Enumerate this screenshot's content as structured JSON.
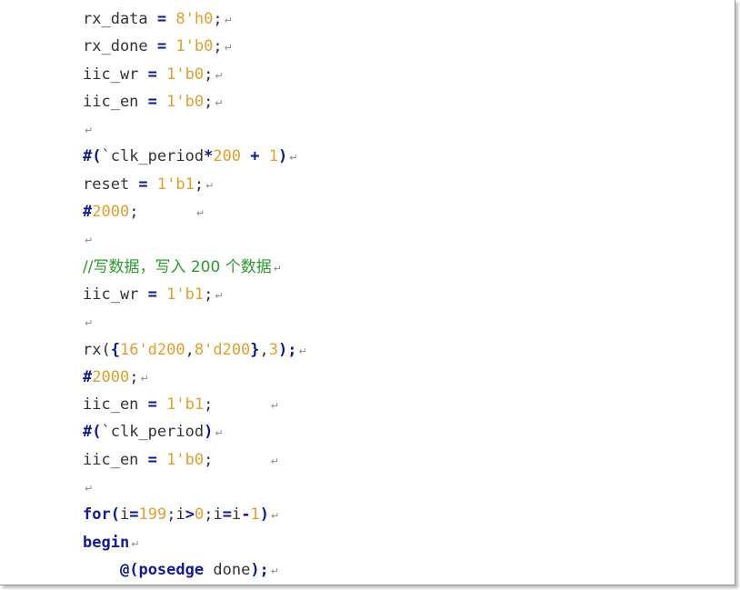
{
  "colors": {
    "text": "#333333",
    "number": "#e0a030",
    "operator": "#111a80",
    "keyword": "#141b8c",
    "comment": "#2e9a2e",
    "mark": "#8a8a8a"
  },
  "paragraph_mark": "↵",
  "lines": [
    {
      "indent": 0,
      "tokens": [
        {
          "t": "rx_data ",
          "c": "text"
        },
        {
          "t": "=",
          "c": "op"
        },
        {
          "t": " ",
          "c": "text"
        },
        {
          "t": "8'h0",
          "c": "number"
        },
        {
          "t": ";",
          "c": "text"
        }
      ],
      "trail": 0
    },
    {
      "indent": 0,
      "tokens": [
        {
          "t": "rx_done ",
          "c": "text"
        },
        {
          "t": "=",
          "c": "op"
        },
        {
          "t": " ",
          "c": "text"
        },
        {
          "t": "1'b0",
          "c": "number"
        },
        {
          "t": ";",
          "c": "text"
        }
      ],
      "trail": 0
    },
    {
      "indent": 0,
      "tokens": [
        {
          "t": "iic_wr ",
          "c": "text"
        },
        {
          "t": "=",
          "c": "op"
        },
        {
          "t": " ",
          "c": "text"
        },
        {
          "t": "1'b0",
          "c": "number"
        },
        {
          "t": ";",
          "c": "text"
        }
      ],
      "trail": 0
    },
    {
      "indent": 0,
      "tokens": [
        {
          "t": "iic_en ",
          "c": "text"
        },
        {
          "t": "=",
          "c": "op"
        },
        {
          "t": " ",
          "c": "text"
        },
        {
          "t": "1'b0",
          "c": "number"
        },
        {
          "t": ";",
          "c": "text"
        }
      ],
      "trail": 0
    },
    {
      "indent": 0,
      "tokens": [],
      "trail": 0
    },
    {
      "indent": 0,
      "tokens": [
        {
          "t": "#(",
          "c": "op"
        },
        {
          "t": "`clk_period",
          "c": "text"
        },
        {
          "t": "*",
          "c": "op"
        },
        {
          "t": "200",
          "c": "number"
        },
        {
          "t": " ",
          "c": "text"
        },
        {
          "t": "+",
          "c": "op"
        },
        {
          "t": " ",
          "c": "text"
        },
        {
          "t": "1",
          "c": "number"
        },
        {
          "t": ")",
          "c": "op"
        }
      ],
      "trail": 0
    },
    {
      "indent": 0,
      "tokens": [
        {
          "t": "reset ",
          "c": "text"
        },
        {
          "t": "=",
          "c": "op"
        },
        {
          "t": " ",
          "c": "text"
        },
        {
          "t": "1'b1",
          "c": "number"
        },
        {
          "t": ";",
          "c": "text"
        }
      ],
      "trail": 0
    },
    {
      "indent": 0,
      "tokens": [
        {
          "t": "#",
          "c": "op"
        },
        {
          "t": "2000",
          "c": "number"
        },
        {
          "t": ";",
          "c": "text"
        }
      ],
      "trail": 6
    },
    {
      "indent": 0,
      "tokens": [],
      "trail": 0
    },
    {
      "indent": 0,
      "tokens": [
        {
          "t": "//写数据，写入 200 个数据",
          "c": "comment"
        }
      ],
      "trail": 0
    },
    {
      "indent": 0,
      "tokens": [
        {
          "t": "iic_wr ",
          "c": "text"
        },
        {
          "t": "=",
          "c": "op"
        },
        {
          "t": " ",
          "c": "text"
        },
        {
          "t": "1'b1",
          "c": "number"
        },
        {
          "t": ";",
          "c": "text"
        }
      ],
      "trail": 0
    },
    {
      "indent": 0,
      "tokens": [],
      "trail": 0
    },
    {
      "indent": 0,
      "tokens": [
        {
          "t": "rx(",
          "c": "text"
        },
        {
          "t": "{",
          "c": "op"
        },
        {
          "t": "16'd200",
          "c": "number"
        },
        {
          "t": ",",
          "c": "text"
        },
        {
          "t": "8'd200",
          "c": "number"
        },
        {
          "t": "}",
          "c": "op"
        },
        {
          "t": ",",
          "c": "text"
        },
        {
          "t": "3",
          "c": "number"
        },
        {
          "t": ");",
          "c": "op"
        }
      ],
      "trail": 0
    },
    {
      "indent": 0,
      "tokens": [
        {
          "t": "#",
          "c": "op"
        },
        {
          "t": "2000",
          "c": "number"
        },
        {
          "t": ";",
          "c": "text"
        }
      ],
      "trail": 0
    },
    {
      "indent": 0,
      "tokens": [
        {
          "t": "iic_en ",
          "c": "text"
        },
        {
          "t": "=",
          "c": "op"
        },
        {
          "t": " ",
          "c": "text"
        },
        {
          "t": "1'b1",
          "c": "number"
        },
        {
          "t": ";",
          "c": "text"
        }
      ],
      "trail": 6
    },
    {
      "indent": 0,
      "tokens": [
        {
          "t": "#(",
          "c": "op"
        },
        {
          "t": "`clk_period",
          "c": "text"
        },
        {
          "t": ")",
          "c": "op"
        }
      ],
      "trail": 0
    },
    {
      "indent": 0,
      "tokens": [
        {
          "t": "iic_en ",
          "c": "text"
        },
        {
          "t": "=",
          "c": "op"
        },
        {
          "t": " ",
          "c": "text"
        },
        {
          "t": "1'b0",
          "c": "number"
        },
        {
          "t": ";",
          "c": "text"
        }
      ],
      "trail": 6
    },
    {
      "indent": 0,
      "tokens": [],
      "trail": 0
    },
    {
      "indent": 0,
      "tokens": [
        {
          "t": "for",
          "c": "keyword"
        },
        {
          "t": "(",
          "c": "op"
        },
        {
          "t": "i",
          "c": "text"
        },
        {
          "t": "=",
          "c": "op"
        },
        {
          "t": "199",
          "c": "number"
        },
        {
          "t": ";",
          "c": "text"
        },
        {
          "t": "i",
          "c": "text"
        },
        {
          "t": ">",
          "c": "op"
        },
        {
          "t": "0",
          "c": "number"
        },
        {
          "t": ";",
          "c": "text"
        },
        {
          "t": "i",
          "c": "text"
        },
        {
          "t": "=",
          "c": "op"
        },
        {
          "t": "i",
          "c": "text"
        },
        {
          "t": "-",
          "c": "op"
        },
        {
          "t": "1",
          "c": "number"
        },
        {
          "t": ")",
          "c": "op"
        }
      ],
      "trail": 0
    },
    {
      "indent": 0,
      "tokens": [
        {
          "t": "begin",
          "c": "keyword"
        }
      ],
      "trail": 0
    },
    {
      "indent": 4,
      "tokens": [
        {
          "t": "@",
          "c": "op"
        },
        {
          "t": "(",
          "c": "op"
        },
        {
          "t": "posedge",
          "c": "keyword"
        },
        {
          "t": " ",
          "c": "text"
        },
        {
          "t": "done",
          "c": "text"
        },
        {
          "t": ");",
          "c": "op"
        }
      ],
      "trail": 0
    }
  ]
}
